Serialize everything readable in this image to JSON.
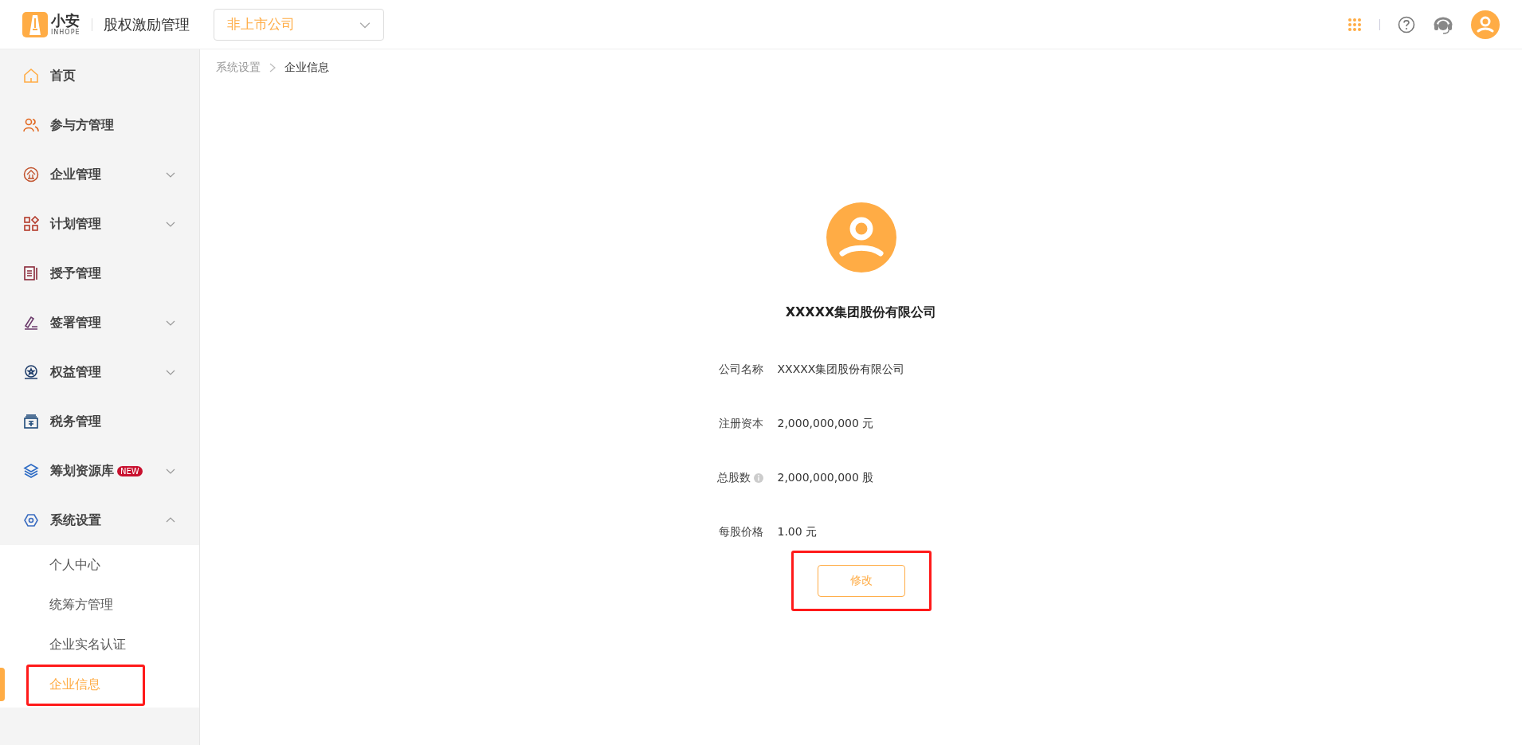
{
  "header": {
    "logo": {
      "name": "小安",
      "sub": "INHOPE"
    },
    "app_title": "股权激励管理",
    "company_select": {
      "value": "非上市公司"
    }
  },
  "sidebar": {
    "items": [
      {
        "label": "首页"
      },
      {
        "label": "参与方管理"
      },
      {
        "label": "企业管理",
        "expanded": false
      },
      {
        "label": "计划管理",
        "expanded": false
      },
      {
        "label": "授予管理"
      },
      {
        "label": "签署管理",
        "expanded": false
      },
      {
        "label": "权益管理",
        "expanded": false
      },
      {
        "label": "税务管理"
      },
      {
        "label": "筹划资源库",
        "badge": "NEW",
        "expanded": false
      },
      {
        "label": "系统设置",
        "expanded": true,
        "children": [
          {
            "label": "个人中心",
            "selected": false,
            "highlighted": false
          },
          {
            "label": "统筹方管理",
            "selected": false,
            "highlighted": false
          },
          {
            "label": "企业实名认证",
            "selected": false,
            "highlighted": false
          },
          {
            "label": "企业信息",
            "selected": true,
            "highlighted": true
          }
        ]
      }
    ]
  },
  "breadcrumb": [
    "系统设置",
    "企业信息"
  ],
  "company": {
    "title": "XXXXX集团股份有限公司",
    "fields": [
      {
        "label": "公司名称",
        "value": "XXXXX集团股份有限公司"
      },
      {
        "label": "注册资本",
        "value": "2,000,000,000 元"
      },
      {
        "label": "总股数",
        "value": "2,000,000,000 股",
        "info": true
      },
      {
        "label": "每股价格",
        "value": "1.00 元"
      }
    ],
    "edit_button": {
      "label": "修改",
      "highlighted": true
    }
  }
}
